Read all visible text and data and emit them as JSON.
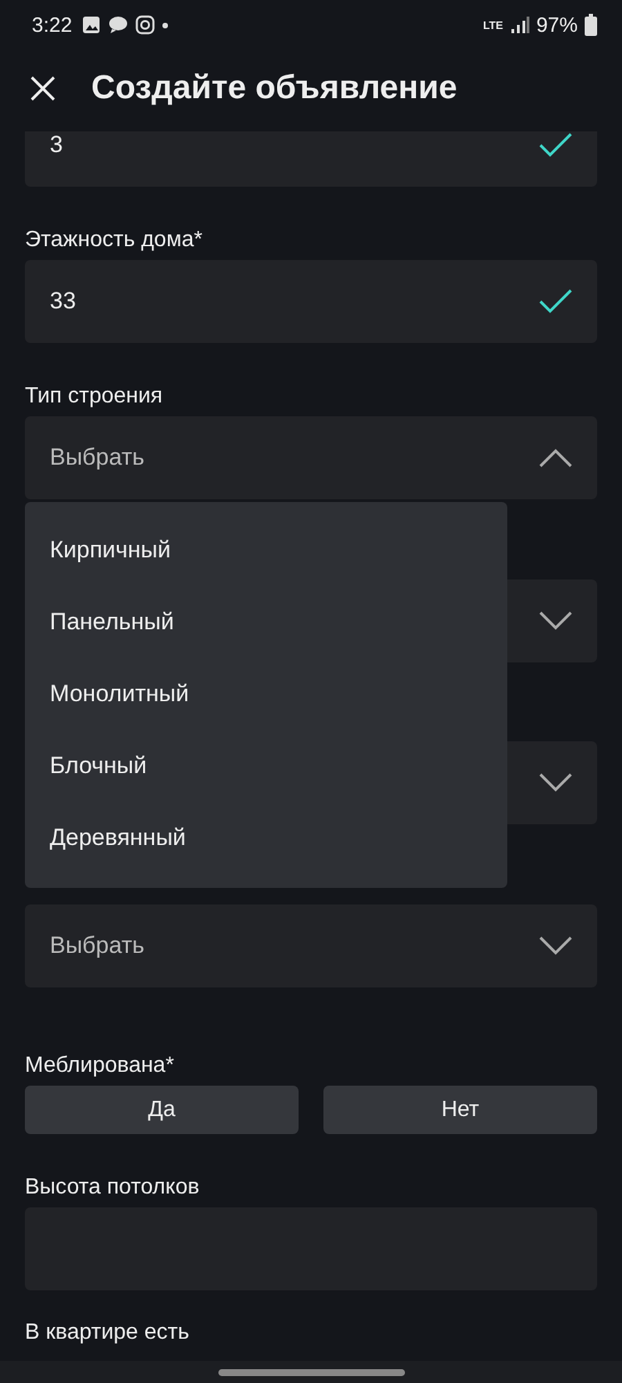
{
  "status_bar": {
    "time": "3:22",
    "network": "LTE",
    "battery": "97%"
  },
  "header": {
    "title": "Создайте объявление"
  },
  "form": [
    {
      "kind": "input",
      "value": "3",
      "valid": true
    },
    {
      "kind": "input",
      "label": "Этажность дома*",
      "value": "33",
      "valid": true
    },
    {
      "kind": "select",
      "label": "Тип строения",
      "placeholder": "Выбрать",
      "expanded": true,
      "options": [
        {
          "label": "Кирпичный"
        },
        {
          "label": "Панельный"
        },
        {
          "label": "Монолитный"
        },
        {
          "label": "Блочный"
        },
        {
          "label": "Деревянный"
        }
      ]
    },
    {
      "kind": "select",
      "expanded": false
    },
    {
      "kind": "select",
      "expanded": false
    },
    {
      "kind": "select",
      "placeholder": "Выбрать",
      "expanded": false
    },
    {
      "kind": "toggle",
      "label": "Меблирована*",
      "options": [
        {
          "label": "Да",
          "selected": false
        },
        {
          "label": "Нет",
          "selected": false
        }
      ]
    },
    {
      "kind": "input",
      "label": "Высота потолков"
    },
    {
      "kind": "heading",
      "label": "В квартире есть"
    }
  ]
}
